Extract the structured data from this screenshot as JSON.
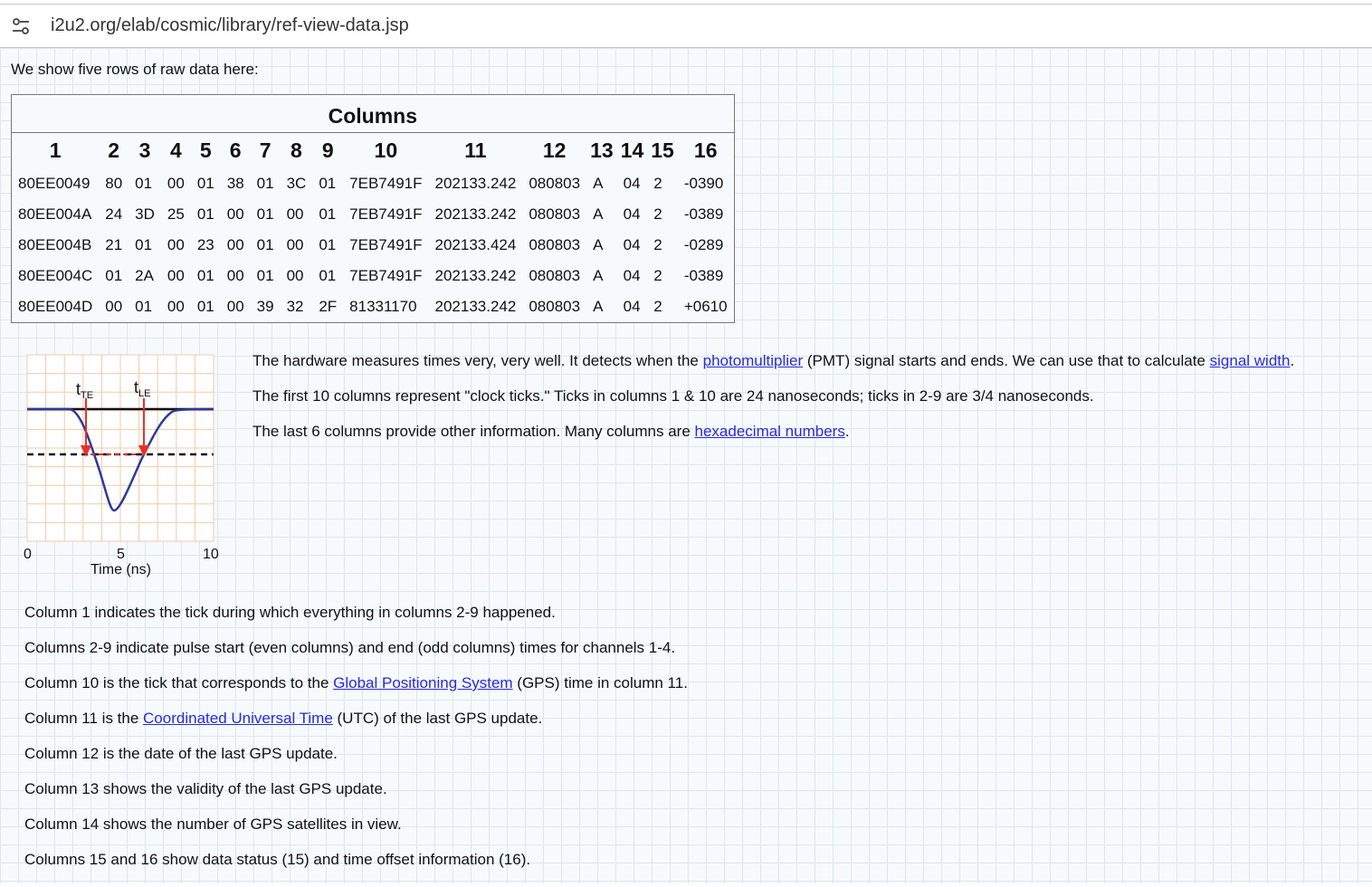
{
  "browser": {
    "url": "i2u2.org/elab/cosmic/library/ref-view-data.jsp"
  },
  "intro": "We show five rows of raw data here:",
  "table": {
    "caption": "Columns",
    "headers": [
      "1",
      "2",
      "3",
      "4",
      "5",
      "6",
      "7",
      "8",
      "9",
      "10",
      "11",
      "12",
      "13",
      "14",
      "15",
      "16"
    ],
    "rows": [
      [
        "80EE0049",
        "80",
        "01",
        "00",
        "01",
        "38",
        "01",
        "3C",
        "01",
        "7EB7491F",
        "202133.242",
        "080803",
        "A",
        "04",
        "2",
        "-0390"
      ],
      [
        "80EE004A",
        "24",
        "3D",
        "25",
        "01",
        "00",
        "01",
        "00",
        "01",
        "7EB7491F",
        "202133.242",
        "080803",
        "A",
        "04",
        "2",
        "-0389"
      ],
      [
        "80EE004B",
        "21",
        "01",
        "00",
        "23",
        "00",
        "01",
        "00",
        "01",
        "7EB7491F",
        "202133.424",
        "080803",
        "A",
        "04",
        "2",
        "-0289"
      ],
      [
        "80EE004C",
        "01",
        "2A",
        "00",
        "01",
        "00",
        "01",
        "00",
        "01",
        "7EB7491F",
        "202133.242",
        "080803",
        "A",
        "04",
        "2",
        "-0389"
      ],
      [
        "80EE004D",
        "00",
        "01",
        "00",
        "01",
        "00",
        "39",
        "32",
        "2F",
        "81331170",
        "202133.242",
        "080803",
        "A",
        "04",
        "2",
        "+0610"
      ]
    ]
  },
  "figure": {
    "label_te": "t",
    "label_te_sub": "TE",
    "label_le": "t",
    "label_le_sub": "LE",
    "tick_0": "0",
    "tick_5": "5",
    "tick_10": "10",
    "xlabel": "Time (ns)"
  },
  "side": {
    "p1_pre": "The hardware measures times very, very well. It detects when the ",
    "p1_link1": "photomultiplier",
    "p1_mid": " (PMT) signal starts and ends. We can use that to calculate ",
    "p1_link2": "signal width",
    "p1_end": ".",
    "p2": "The first 10 columns represent \"clock ticks.\" Ticks in columns 1 & 10 are 24 nanoseconds; ticks in 2-9 are 3/4 nanoseconds.",
    "p3_pre": "The last 6 columns provide other information. Many columns are ",
    "p3_link": "hexadecimal numbers",
    "p3_end": "."
  },
  "notes": {
    "n1": "Column 1 indicates the tick during which everything in columns 2-9 happened.",
    "n2": "Columns 2-9 indicate pulse start (even columns) and end (odd columns) times for channels 1-4.",
    "n3_pre": "Column 10 is the tick that corresponds to the ",
    "n3_link": "Global Positioning System",
    "n3_end": " (GPS) time in column 11.",
    "n4_pre": "Column 11 is the ",
    "n4_link": "Coordinated Universal Time",
    "n4_end": " (UTC) of the last GPS update.",
    "n5": "Column 12 is the date of the last GPS update.",
    "n6": "Column 13 shows the validity of the last GPS update.",
    "n7": "Column 14 shows the number of GPS satellites in view.",
    "n8": "Columns 15 and 16 show data status (15) and time offset information (16)."
  }
}
